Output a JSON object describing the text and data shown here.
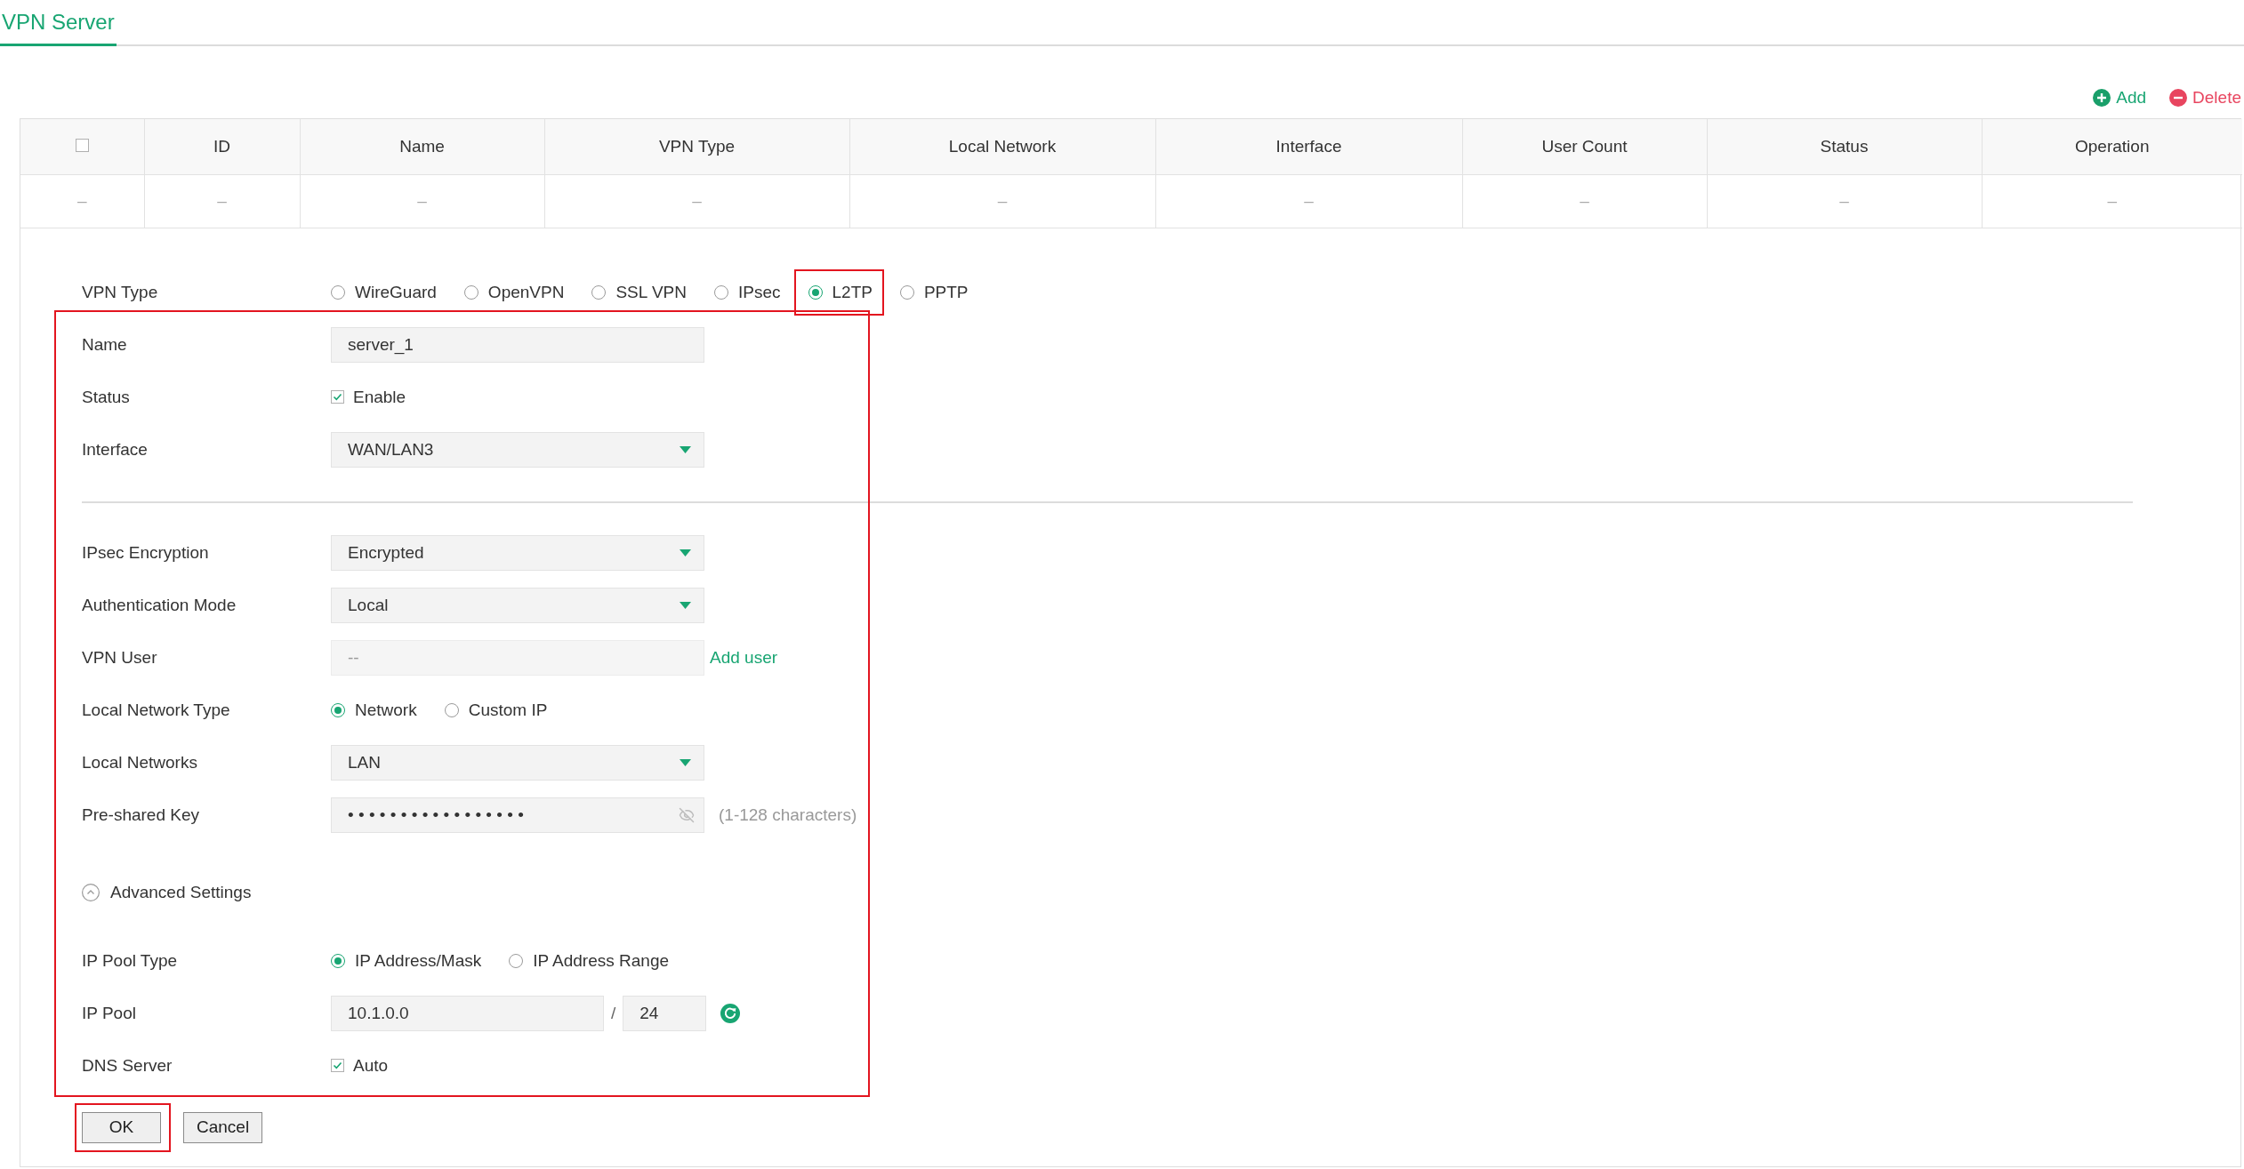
{
  "tabs": [
    {
      "label": "VPN Server",
      "selected": true
    }
  ],
  "actions": [
    {
      "kind": "add",
      "label": "Add"
    },
    {
      "kind": "delete",
      "label": "Delete"
    }
  ],
  "table": {
    "select_all": {
      "checked": false
    },
    "columns": [
      "",
      "ID",
      "Name",
      "VPN Type",
      "Local Network",
      "Interface",
      "User Count",
      "Status",
      "Operation"
    ],
    "rows": [
      {
        "cells": [
          "–",
          "–",
          "–",
          "–",
          "–",
          "–",
          "–",
          "–",
          "–"
        ]
      }
    ]
  },
  "form": {
    "vpn_type": {
      "label": "VPN Type",
      "options": [
        {
          "label": "WireGuard",
          "selected": false,
          "highlighted": false
        },
        {
          "label": "OpenVPN",
          "selected": false,
          "highlighted": false
        },
        {
          "label": "SSL VPN",
          "selected": false,
          "highlighted": false
        },
        {
          "label": "IPsec",
          "selected": false,
          "highlighted": false
        },
        {
          "label": "L2TP",
          "selected": true,
          "highlighted": true
        },
        {
          "label": "PPTP",
          "selected": false,
          "highlighted": false
        }
      ]
    },
    "section": {
      "highlighted": true,
      "fields": [
        {
          "kind": "text",
          "label": "Name",
          "value": "server_1",
          "disabled": false
        },
        {
          "kind": "checkbox",
          "label": "Status",
          "option": "Enable",
          "checked": true
        },
        {
          "kind": "select",
          "label": "Interface",
          "value": "WAN/LAN3"
        },
        {
          "kind": "divider"
        },
        {
          "kind": "select",
          "label": "IPsec Encryption",
          "value": "Encrypted"
        },
        {
          "kind": "select",
          "label": "Authentication Mode",
          "value": "Local"
        },
        {
          "kind": "text",
          "label": "VPN User",
          "placeholder": "--",
          "disabled": true,
          "link": "Add user"
        },
        {
          "kind": "radio",
          "label": "Local Network Type",
          "options": [
            {
              "label": "Network",
              "selected": true
            },
            {
              "label": "Custom IP",
              "selected": false
            }
          ]
        },
        {
          "kind": "select",
          "label": "Local Networks",
          "value": "LAN"
        },
        {
          "kind": "password",
          "label": "Pre-shared Key",
          "value": "•••••••••••••••••",
          "hint": "(1-128 characters)"
        },
        {
          "kind": "expander",
          "label": "Advanced Settings",
          "expanded": true
        },
        {
          "kind": "radio",
          "label": "IP Pool Type",
          "options": [
            {
              "label": "IP Address/Mask",
              "selected": true
            },
            {
              "label": "IP Address Range",
              "selected": false
            }
          ]
        },
        {
          "kind": "ip_pool",
          "label": "IP Pool",
          "address": "10.1.0.0",
          "separator": "/",
          "mask": "24"
        },
        {
          "kind": "checkbox",
          "label": "DNS Server",
          "option": "Auto",
          "checked": true
        }
      ]
    },
    "buttons": [
      {
        "label": "OK",
        "highlighted": true
      },
      {
        "label": "Cancel",
        "highlighted": false
      }
    ]
  }
}
